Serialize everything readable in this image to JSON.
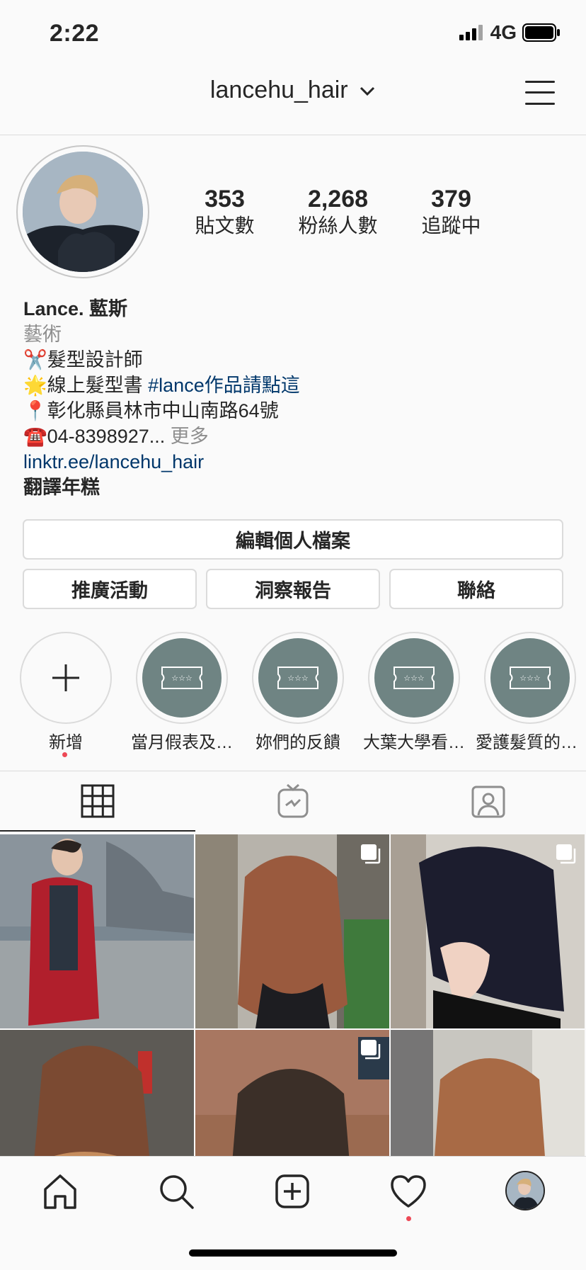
{
  "status": {
    "time": "2:22",
    "network": "4G"
  },
  "header": {
    "username": "lancehu_hair"
  },
  "profile": {
    "stats": [
      {
        "num": "353",
        "label": "貼文數"
      },
      {
        "num": "2,268",
        "label": "粉絲人數"
      },
      {
        "num": "379",
        "label": "追蹤中"
      }
    ],
    "name": "Lance. 藍斯",
    "category": "藝術",
    "bio": {
      "line1_emoji": "✂️",
      "line1_text": "髮型設計師",
      "line2_emoji": "🌟",
      "line2_text": "線上髮型書 ",
      "line2_tag": "#lance作品請點這",
      "line3_emoji": "📍",
      "line3_text": "彰化縣員林市中山南路64號",
      "line4_emoji": "☎️",
      "line4_text": "04-8398927... ",
      "line4_more": "更多"
    },
    "link": "linktr.ee/lancehu_hair",
    "translate": "翻譯年糕"
  },
  "buttons": {
    "edit_profile": "編輯個人檔案",
    "promotions": "推廣活動",
    "insights": "洞察報告",
    "contact": "聯絡"
  },
  "highlights": [
    {
      "label": "新增"
    },
    {
      "label": "當月假表及…"
    },
    {
      "label": "妳們的反饋"
    },
    {
      "label": "大葉大學看…"
    },
    {
      "label": "愛護髮質的…"
    }
  ],
  "tabs": [
    "grid",
    "igtv",
    "tagged"
  ],
  "colors": {
    "accent_link": "#00376b",
    "highlight_fill": "#6f8483",
    "notification_dot": "#ed4956",
    "border": "#dbdbdb"
  },
  "icons": [
    "signal-icon",
    "battery-icon",
    "chevron-down-icon",
    "hamburger-menu-icon",
    "plus-icon",
    "ticket-icon",
    "grid-icon",
    "igtv-icon",
    "tagged-icon",
    "multi-post-icon",
    "home-icon",
    "search-icon",
    "new-post-icon",
    "heart-icon",
    "profile-avatar-icon"
  ]
}
